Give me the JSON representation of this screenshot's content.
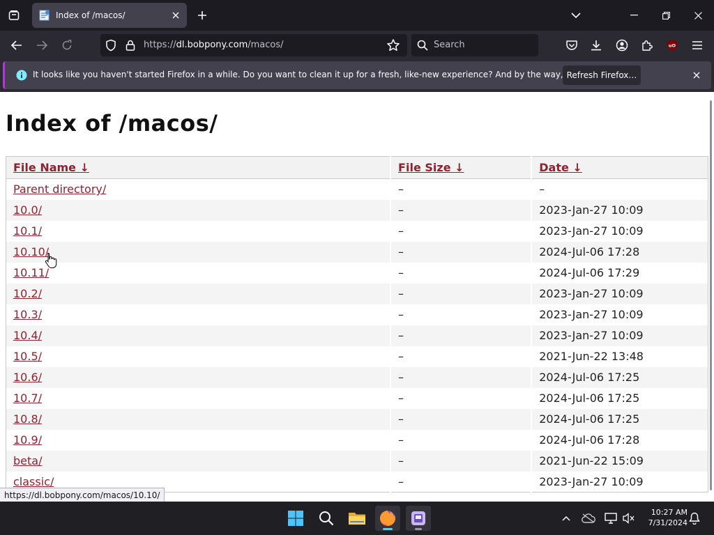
{
  "browser": {
    "tab": {
      "title": "Index of /macos/"
    },
    "url": {
      "scheme": "https://",
      "host": "dl.bobpony.com",
      "path": "/macos/"
    },
    "search_placeholder": "Search",
    "notification": {
      "text": "It looks like you haven't started Firefox in a while. Do you want to clean it up for a fresh, like-new experience? And by the way, welcome back!",
      "button_label": "Refresh Firefox…"
    },
    "status_url": "https://dl.bobpony.com/macos/10.10/",
    "accent_color": "#b833e1"
  },
  "page": {
    "title": "Index of /macos/",
    "columns": [
      {
        "label": "File Name",
        "sort_arrow": "↓"
      },
      {
        "label": "File Size",
        "sort_arrow": "↓"
      },
      {
        "label": "Date",
        "sort_arrow": "↓"
      }
    ],
    "rows": [
      {
        "name": "Parent directory/",
        "size": "–",
        "date": "–"
      },
      {
        "name": "10.0/",
        "size": "–",
        "date": "2023-Jan-27 10:09"
      },
      {
        "name": "10.1/",
        "size": "–",
        "date": "2023-Jan-27 10:09"
      },
      {
        "name": "10.10/",
        "size": "–",
        "date": "2024-Jul-06 17:28"
      },
      {
        "name": "10.11/",
        "size": "–",
        "date": "2024-Jul-06 17:29"
      },
      {
        "name": "10.2/",
        "size": "–",
        "date": "2023-Jan-27 10:09"
      },
      {
        "name": "10.3/",
        "size": "–",
        "date": "2023-Jan-27 10:09"
      },
      {
        "name": "10.4/",
        "size": "–",
        "date": "2023-Jan-27 10:09"
      },
      {
        "name": "10.5/",
        "size": "–",
        "date": "2021-Jun-22 13:48"
      },
      {
        "name": "10.6/",
        "size": "–",
        "date": "2024-Jul-06 17:25"
      },
      {
        "name": "10.7/",
        "size": "–",
        "date": "2024-Jul-06 17:25"
      },
      {
        "name": "10.8/",
        "size": "–",
        "date": "2024-Jul-06 17:25"
      },
      {
        "name": "10.9/",
        "size": "–",
        "date": "2024-Jul-06 17:28"
      },
      {
        "name": "beta/",
        "size": "–",
        "date": "2021-Jun-22 15:09"
      },
      {
        "name": "classic/",
        "size": "–",
        "date": "2023-Jan-27 10:09"
      }
    ],
    "link_color": "#8b2430"
  },
  "taskbar": {
    "time": "10:27 AM",
    "date": "7/31/2024",
    "apps": [
      "start-icon",
      "search-icon",
      "file-explorer-icon",
      "firefox-icon",
      "app-icon"
    ]
  }
}
